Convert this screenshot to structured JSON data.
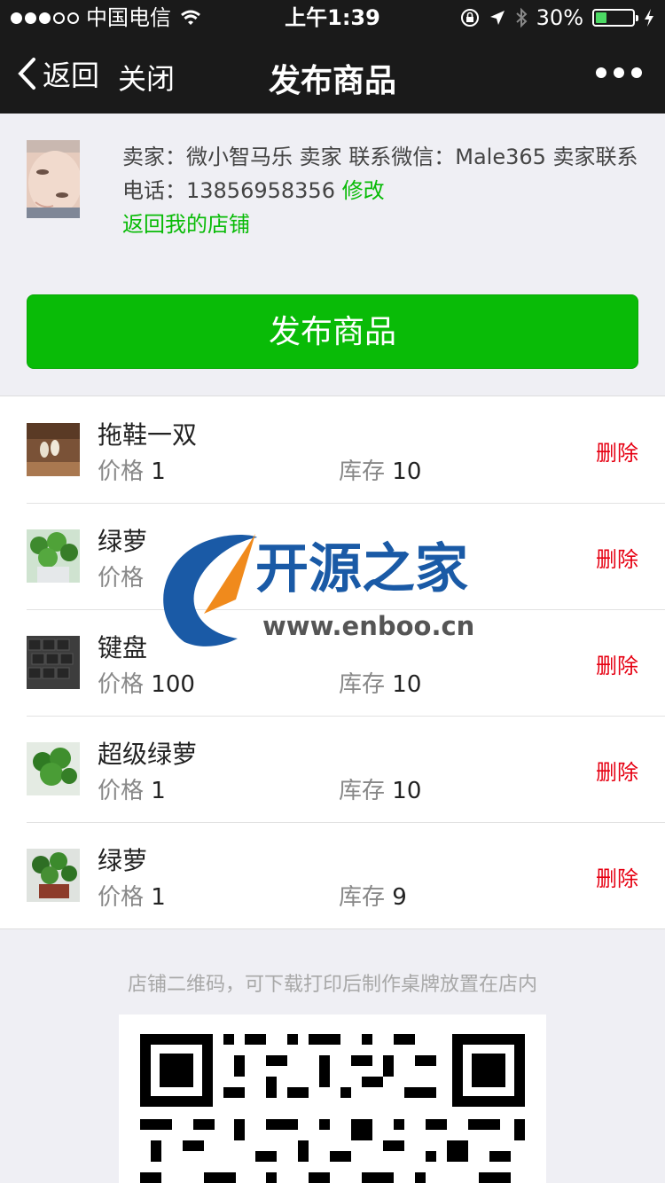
{
  "status_bar": {
    "carrier": "中国电信",
    "time": "上午1:39",
    "battery": "30%",
    "battery_level": 0.3,
    "signal_bars": 3,
    "icons": [
      "signal-dots-icon",
      "wifi-icon",
      "rotation-lock-icon",
      "location-arrow-icon",
      "bluetooth-icon",
      "battery-icon",
      "charging-bolt-icon"
    ]
  },
  "nav": {
    "back_label": "返回",
    "close_label": "关闭",
    "title": "发布商品",
    "more_icon": "more-dots-icon"
  },
  "seller": {
    "line1": "卖家：微小智马乐 卖家 联系微信：Male365 卖家联系",
    "line2_prefix": "电话：13856958356 ",
    "edit_link": "修改",
    "shop_link": "返回我的店铺"
  },
  "publish_button": "发布商品",
  "labels": {
    "price": "价格",
    "stock": "库存",
    "delete": "删除"
  },
  "products": [
    {
      "name": "拖鞋一双",
      "price": "1",
      "stock": "10"
    },
    {
      "name": "绿萝",
      "price": "",
      "stock": ""
    },
    {
      "name": "键盘",
      "price": "100",
      "stock": "10"
    },
    {
      "name": "超级绿萝",
      "price": "1",
      "stock": "10"
    },
    {
      "name": "绿萝",
      "price": "1",
      "stock": "9"
    }
  ],
  "qr": {
    "caption": "店铺二维码，可下载打印后制作桌牌放置在店内"
  },
  "watermark": {
    "title": "开源之家",
    "url": "www.enboo.cn"
  },
  "colors": {
    "accent_green": "#09bb07",
    "delete_red": "#e60012",
    "bar_dark": "#1a1a1a",
    "background": "#efeff4"
  }
}
